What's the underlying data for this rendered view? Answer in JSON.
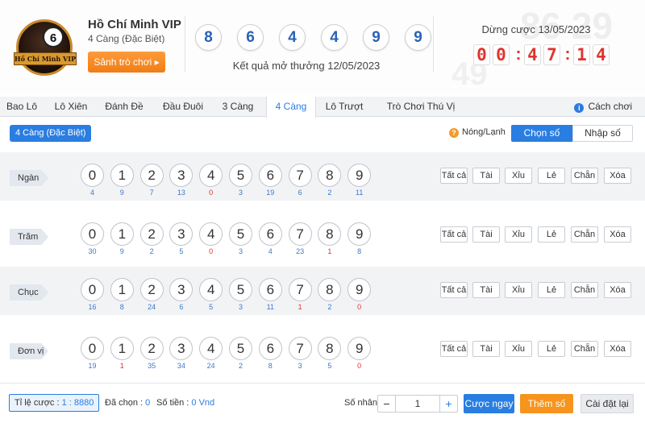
{
  "header": {
    "logo_text": "Hồ Chí Minh VIP",
    "logo_ball": "6",
    "title": "Hồ Chí Minh VIP",
    "subtitle": "4 Càng (Đặc Biệt)",
    "lobby_button": "Sảnh trò chơi",
    "results": [
      "8",
      "6",
      "4",
      "4",
      "9",
      "9"
    ],
    "result_caption": "Kết quả mở thưởng 12/05/2023",
    "stop_label": "Dừng cược 13/05/2023",
    "countdown": [
      "0",
      "0",
      "4",
      "7",
      "1",
      "4"
    ]
  },
  "tabs": {
    "items": [
      "Bao Lô",
      "Lô Xiên",
      "Đánh Đề",
      "Đầu Đuôi",
      "3 Càng",
      "4 Càng",
      "Lô Trượt",
      "Trò Chơi Thú Vị"
    ],
    "active": "4 Càng",
    "how_to_play": "Cách chơi"
  },
  "subbar": {
    "bet_type": "4 Càng (Đặc Biệt)",
    "hot_cold": "Nóng/Lạnh",
    "choose_number": "Chọn số",
    "enter_number": "Nhập số"
  },
  "digits": [
    "0",
    "1",
    "2",
    "3",
    "4",
    "5",
    "6",
    "7",
    "8",
    "9"
  ],
  "quick_buttons": [
    "Tất cả",
    "Tài",
    "Xỉu",
    "Lẻ",
    "Chẵn",
    "Xóa"
  ],
  "rows": [
    {
      "label": "Ngàn",
      "freq": [
        "4",
        "9",
        "7",
        "13",
        "0",
        "3",
        "19",
        "6",
        "2",
        "11"
      ]
    },
    {
      "label": "Trăm",
      "freq": [
        "30",
        "9",
        "2",
        "5",
        "0",
        "3",
        "4",
        "23",
        "1",
        "8"
      ]
    },
    {
      "label": "Chục",
      "freq": [
        "16",
        "8",
        "24",
        "6",
        "5",
        "3",
        "11",
        "1",
        "2",
        "0"
      ]
    },
    {
      "label": "Đơn vị",
      "freq": [
        "19",
        "1",
        "35",
        "34",
        "24",
        "2",
        "8",
        "3",
        "5",
        "0"
      ]
    }
  ],
  "footer": {
    "rate_label": "Tỉ lệ cược : ",
    "rate_value": "1 : 8880",
    "selected_label": "Đã chọn : ",
    "selected_value": "0",
    "amount_label": "Số tiền : ",
    "amount_value": "0 Vnd",
    "multiplier_label": "Số nhân :",
    "multiplier_value": "1",
    "bet_now": "Cược ngay",
    "add_number": "Thêm số",
    "reset": "Cài đặt lại"
  },
  "colors": {
    "accent": "#2a7de1",
    "orange": "#f7941d",
    "countdown": "#e0342e",
    "cold": "#e0342e"
  }
}
